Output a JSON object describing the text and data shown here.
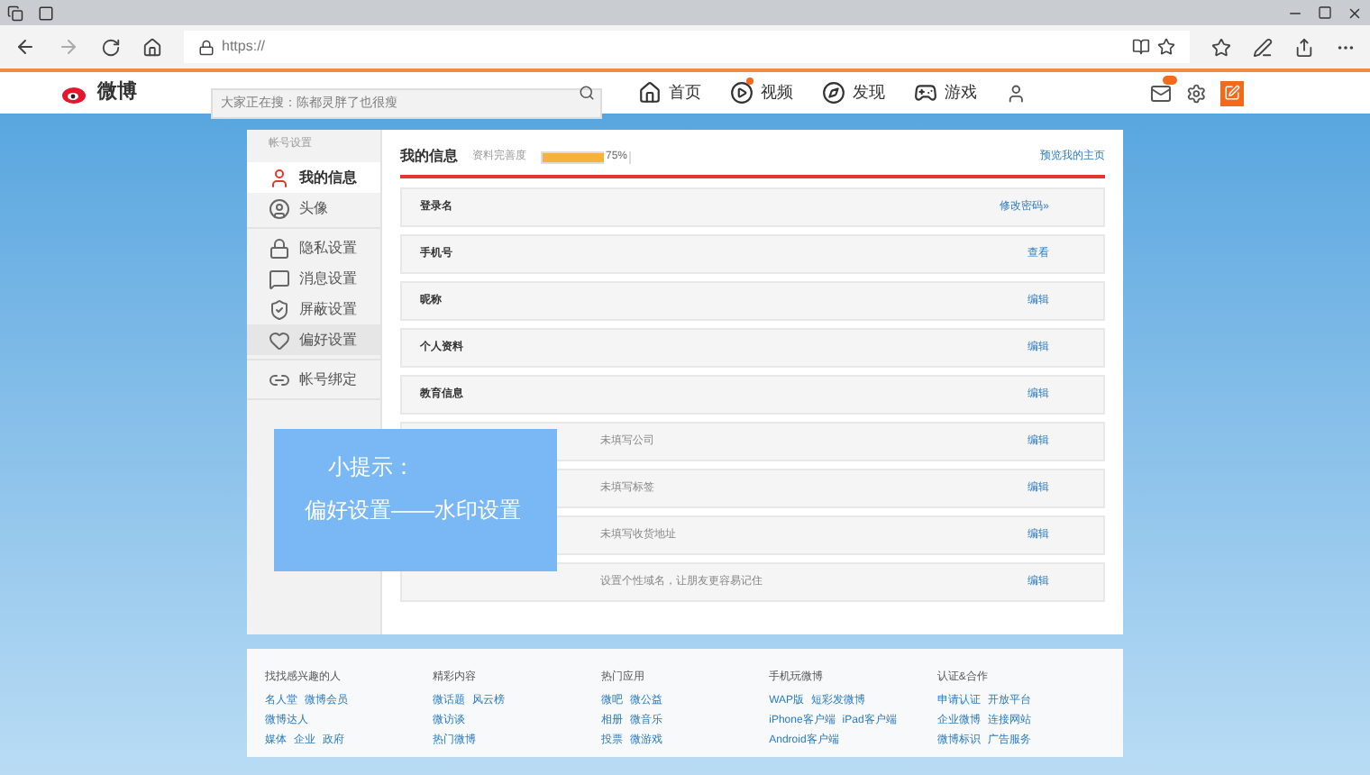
{
  "browser": {
    "address": "https://"
  },
  "nav": {
    "logo": "微博",
    "search_placeholder": "大家正在搜：陈都灵胖了也很瘦",
    "items": [
      {
        "kind": "home",
        "label": "首页",
        "dot": false
      },
      {
        "kind": "video",
        "label": "视频",
        "dot": true
      },
      {
        "kind": "discover",
        "label": "发现",
        "dot": false
      },
      {
        "kind": "game",
        "label": "游戏",
        "dot": false
      }
    ]
  },
  "sidebar": {
    "heading": "帐号设置",
    "groups": [
      [
        {
          "kind": "user",
          "label": "我的信息",
          "selected": true,
          "hover": false
        },
        {
          "kind": "avatar",
          "label": "头像",
          "selected": false,
          "hover": false
        }
      ],
      [
        {
          "kind": "lock",
          "label": "隐私设置",
          "selected": false,
          "hover": false
        },
        {
          "kind": "message",
          "label": "消息设置",
          "selected": false,
          "hover": false
        },
        {
          "kind": "shield",
          "label": "屏蔽设置",
          "selected": false,
          "hover": false
        },
        {
          "kind": "heart",
          "label": "偏好设置",
          "selected": false,
          "hover": true
        }
      ],
      [
        {
          "kind": "link",
          "label": "帐号绑定",
          "selected": false,
          "hover": false
        }
      ]
    ]
  },
  "main": {
    "title": "我的信息",
    "progress_label": "资料完善度",
    "level": 0.75,
    "reading": "75%",
    "preview_link": "预览我的主页",
    "rows": [
      {
        "label": "登录名",
        "value": "",
        "action": "修改密码»"
      },
      {
        "label": "手机号",
        "value": "",
        "action": "查看"
      },
      {
        "label": "昵称",
        "value": "",
        "action": "编辑"
      },
      {
        "label": "个人资料",
        "value": "",
        "action": "编辑"
      },
      {
        "label": "教育信息",
        "value": "",
        "action": "编辑"
      },
      {
        "label": "",
        "value": "未填写公司",
        "action": "编辑"
      },
      {
        "label": "",
        "value": "未填写标签",
        "action": "编辑"
      },
      {
        "label": "",
        "value": "未填写收货地址",
        "action": "编辑"
      },
      {
        "label": "",
        "value": "设置个性域名，让朋友更容易记住",
        "action": "编辑"
      }
    ]
  },
  "tip": {
    "title": "小提示：",
    "text": "偏好设置——水印设置"
  },
  "footer": [
    {
      "heading": "找找感兴趣的人",
      "lines": [
        [
          "名人堂",
          "微博会员"
        ],
        [
          "微博达人"
        ],
        [
          "媒体",
          "企业",
          "政府"
        ]
      ]
    },
    {
      "heading": "精彩内容",
      "lines": [
        [
          "微话题",
          "风云榜"
        ],
        [
          "微访谈"
        ],
        [
          "热门微博"
        ]
      ]
    },
    {
      "heading": "热门应用",
      "lines": [
        [
          "微吧",
          "微公益"
        ],
        [
          "相册",
          "微音乐"
        ],
        [
          "投票",
          "微游戏"
        ]
      ]
    },
    {
      "heading": "手机玩微博",
      "lines": [
        [
          "WAP版",
          "短彩发微博"
        ],
        [
          "iPhone客户端",
          "iPad客户端"
        ],
        [
          "Android客户端"
        ]
      ]
    },
    {
      "heading": "认证&合作",
      "lines": [
        [
          "申请认证",
          "开放平台"
        ],
        [
          "企业微博",
          "连接网站"
        ],
        [
          "微博标识",
          "广告服务"
        ]
      ]
    }
  ]
}
